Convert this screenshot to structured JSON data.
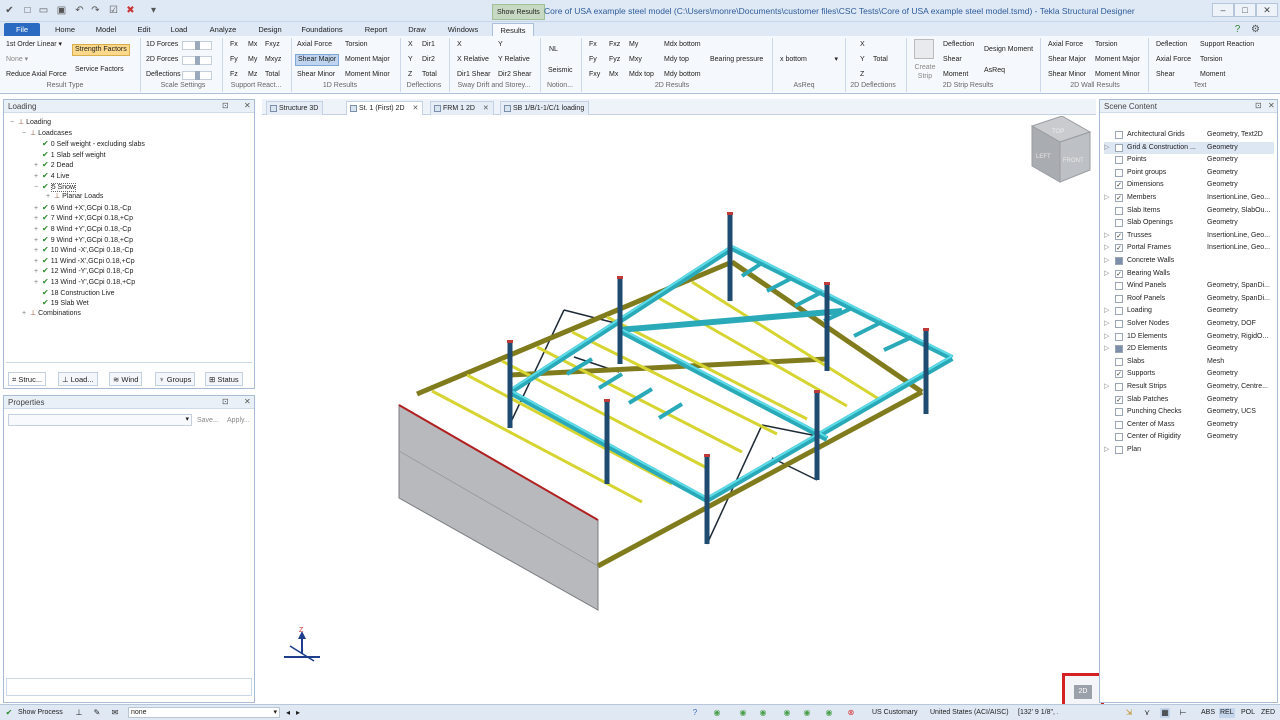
{
  "app": {
    "window_title": "Core of USA example steel model (C:\\Users\\monre\\Documents\\customer files\\CSC Tests\\Core of USA example steel model.tsmd) - Tekla Structural Designer",
    "contextual_tab": "Show Results"
  },
  "menu_tabs": [
    "File",
    "Home",
    "Model",
    "Edit",
    "Load",
    "Analyze",
    "Design",
    "Foundations",
    "Report",
    "Draw",
    "Windows",
    "Results"
  ],
  "ribbon": {
    "result_type": {
      "analysis": "1st Order Linear",
      "combo": "None",
      "strength_factors": "Strength Factors",
      "service_factors": "Service Factors",
      "reduce_axial": "Reduce Axial Force",
      "label": "Result Type"
    },
    "scale": {
      "forces_1d": "1D Forces",
      "forces_2d": "2D Forces",
      "deflections": "Deflections",
      "label": "Scale Settings"
    },
    "support": {
      "row1": [
        "Fx",
        "Mx",
        "Fxyz"
      ],
      "row2": [
        "Fy",
        "My",
        "Mxyz"
      ],
      "row3": [
        "Fz",
        "Mz",
        "Total"
      ],
      "label": "Support React..."
    },
    "results_1d": {
      "items": [
        "Axial Force",
        "Torsion",
        "Shear Major",
        "Moment Major",
        "Shear Minor",
        "Moment Minor"
      ],
      "label": "1D Results"
    },
    "deflections": {
      "row1": [
        "X",
        "Dir1"
      ],
      "row2": [
        "Y",
        "Dir2"
      ],
      "row3": [
        "Z",
        "Total"
      ],
      "label": "Deflections"
    },
    "sway": {
      "items": [
        "X",
        "Y",
        "X Relative",
        "Y Relative",
        "Dir1 Shear",
        "Dir2 Shear"
      ],
      "label": "Sway Drift and Storey..."
    },
    "notion": {
      "nl": "NL",
      "seismic": "Seismic",
      "label": "Notion..."
    },
    "results_2d": {
      "items": [
        "Fx",
        "Fxz",
        "My",
        "Mdx bottom",
        "Fy",
        "Fyz",
        "Mxy",
        "Mdy top",
        "Bearing pressure",
        "Fxy",
        "Mx",
        "Mdx top",
        "Mdy bottom"
      ],
      "label": "2D Results"
    },
    "asreq": {
      "value": "x bottom",
      "label": "AsReq"
    },
    "deflections_2d": {
      "items": [
        "X",
        "Y",
        "Total",
        "Z"
      ],
      "label": "2D Deflections"
    },
    "strip": {
      "create": "Create Strip",
      "items": [
        "Deflection",
        "Design Moment",
        "Shear",
        "Moment",
        "AsReq"
      ],
      "label": "2D Strip Results"
    },
    "wall": {
      "items": [
        "Axial Force",
        "Torsion",
        "Shear Major",
        "Moment Major",
        "Shear Minor",
        "Moment Minor"
      ],
      "label": "2D Wall Results"
    },
    "text": {
      "items": [
        "Deflection",
        "Support Reaction",
        "Axial Force",
        "Torsion",
        "Shear",
        "Moment"
      ],
      "label": "Text"
    }
  },
  "loading_pane": {
    "title": "Loading",
    "tree": [
      {
        "label": "Loading",
        "level": 0,
        "exp": "−",
        "chk": false
      },
      {
        "label": "Loadcases",
        "level": 1,
        "exp": "−",
        "chk": false
      },
      {
        "label": "0 Self weight - excluding slabs",
        "level": 2,
        "exp": "",
        "chk": true
      },
      {
        "label": "1 Slab self weight",
        "level": 2,
        "exp": "",
        "chk": true
      },
      {
        "label": "2 Dead",
        "level": 2,
        "exp": "+",
        "chk": true
      },
      {
        "label": "4 Live",
        "level": 2,
        "exp": "+",
        "chk": true
      },
      {
        "label": "5 Snow",
        "level": 2,
        "exp": "−",
        "chk": true,
        "selected": true
      },
      {
        "label": "Planar Loads",
        "level": 3,
        "exp": "+",
        "chk": false
      },
      {
        "label": "6 Wind +X',GCpi 0.18,-Cp",
        "level": 2,
        "exp": "+",
        "chk": true
      },
      {
        "label": "7 Wind +X',GCpi 0.18,+Cp",
        "level": 2,
        "exp": "+",
        "chk": true
      },
      {
        "label": "8 Wind +Y',GCpi 0.18,-Cp",
        "level": 2,
        "exp": "+",
        "chk": true
      },
      {
        "label": "9 Wind +Y',GCpi 0.18,+Cp",
        "level": 2,
        "exp": "+",
        "chk": true
      },
      {
        "label": "10 Wind -X',GCpi 0.18,-Cp",
        "level": 2,
        "exp": "+",
        "chk": true
      },
      {
        "label": "11 Wind -X',GCpi 0.18,+Cp",
        "level": 2,
        "exp": "+",
        "chk": true
      },
      {
        "label": "12 Wind -Y',GCpi 0.18,-Cp",
        "level": 2,
        "exp": "+",
        "chk": true
      },
      {
        "label": "13 Wind -Y',GCpi 0.18,+Cp",
        "level": 2,
        "exp": "+",
        "chk": true
      },
      {
        "label": "18 Construction Live",
        "level": 2,
        "exp": "",
        "chk": true
      },
      {
        "label": "19 Slab Wet",
        "level": 2,
        "exp": "",
        "chk": true
      },
      {
        "label": "Combinations",
        "level": 1,
        "exp": "+",
        "chk": false
      }
    ],
    "bottom_tabs": [
      "Struc...",
      "Load...",
      "Wind",
      "Groups",
      "Status"
    ]
  },
  "properties_pane": {
    "title": "Properties",
    "save": "Save...",
    "apply": "Apply..."
  },
  "view_tabs": [
    "Structure 3D",
    "St. 1 (First) 2D",
    "FRM 1 2D",
    "SB 1/B/1-1/C/1 loading"
  ],
  "view_cube": {
    "top": "TOP",
    "left": "LEFT",
    "front": "FRONT"
  },
  "axis_label": "Z",
  "view_2d_button": "2D",
  "scene_content": {
    "title": "Scene Content",
    "rows": [
      {
        "name": "Architectural Grids",
        "value": "Geometry, Text2D",
        "state": "",
        "exp": ""
      },
      {
        "name": "Grid & Construction ...",
        "value": "Geometry",
        "state": "",
        "exp": "▷",
        "hi": true
      },
      {
        "name": "Points",
        "value": "Geometry",
        "state": "",
        "exp": ""
      },
      {
        "name": "Point groups",
        "value": "Geometry",
        "state": "",
        "exp": ""
      },
      {
        "name": "Dimensions",
        "value": "Geometry",
        "state": "✓",
        "exp": ""
      },
      {
        "name": "Members",
        "value": "InsertionLine, Geo...",
        "state": "✓",
        "exp": "▷"
      },
      {
        "name": "Slab Items",
        "value": "Geometry, SlabOu...",
        "state": "",
        "exp": ""
      },
      {
        "name": "Slab Openings",
        "value": "Geometry",
        "state": "",
        "exp": ""
      },
      {
        "name": "Trusses",
        "value": "InsertionLine, Geo...",
        "state": "✓",
        "exp": "▷"
      },
      {
        "name": "Portal Frames",
        "value": "InsertionLine, Geo...",
        "state": "✓",
        "exp": "▷"
      },
      {
        "name": "Concrete Walls",
        "value": "",
        "state": "part",
        "exp": "▷"
      },
      {
        "name": "Bearing Walls",
        "value": "",
        "state": "✓",
        "exp": "▷"
      },
      {
        "name": "Wind Panels",
        "value": "Geometry, SpanDi...",
        "state": "",
        "exp": ""
      },
      {
        "name": "Roof Panels",
        "value": "Geometry, SpanDi...",
        "state": "",
        "exp": ""
      },
      {
        "name": "Loading",
        "value": "Geometry",
        "state": "",
        "exp": "▷"
      },
      {
        "name": "Solver Nodes",
        "value": "Geometry, DOF",
        "state": "",
        "exp": "▷"
      },
      {
        "name": "1D Elements",
        "value": "Geometry, RigidO...",
        "state": "",
        "exp": "▷"
      },
      {
        "name": "2D Elements",
        "value": "Geometry",
        "state": "part",
        "exp": "▷"
      },
      {
        "name": "Slabs",
        "value": "Mesh",
        "state": "",
        "exp": ""
      },
      {
        "name": "Supports",
        "value": "Geometry",
        "state": "✓",
        "exp": ""
      },
      {
        "name": "Result Strips",
        "value": "Geometry, Centre...",
        "state": "",
        "exp": "▷"
      },
      {
        "name": "Slab Patches",
        "value": "Geometry",
        "state": "✓",
        "exp": ""
      },
      {
        "name": "Punching Checks",
        "value": "Geometry, UCS",
        "state": "",
        "exp": ""
      },
      {
        "name": "Center of Mass",
        "value": "Geometry",
        "state": "",
        "exp": ""
      },
      {
        "name": "Center of Rigidity",
        "value": "Geometry",
        "state": "",
        "exp": ""
      },
      {
        "name": "Plan",
        "value": "",
        "state": "",
        "exp": "▷"
      }
    ]
  },
  "statusbar": {
    "show_process": "Show Process",
    "filter_value": "none",
    "units": "US Customary",
    "code": "United States (ACI/AISC)",
    "coords": "[132' 9 1/8\", ...",
    "abs": "ABS",
    "rel": "REL",
    "pol": "POL",
    "zed": "ZED"
  },
  "colors": {
    "highlight_box": "#d42020",
    "beam_cyan": "#3cc8d4",
    "beam_yellow": "#d6d431",
    "beam_olive": "#7d7a1f",
    "column": "#234e73"
  }
}
